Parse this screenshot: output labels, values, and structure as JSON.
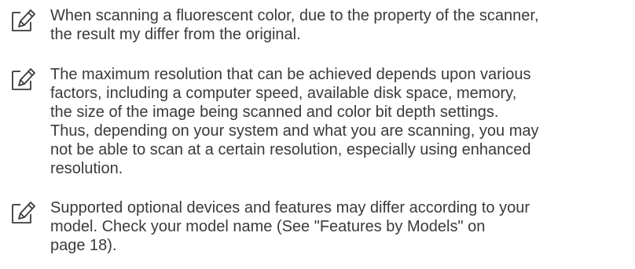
{
  "notes": [
    {
      "icon": "note-pencil-icon",
      "text": "When scanning a fluorescent color, due to the property of the scanner,\nthe result my differ from the original."
    },
    {
      "icon": "note-pencil-icon",
      "text": "The maximum resolution that can be achieved depends upon various\nfactors, including a computer speed, available disk space, memory,\nthe size of the image being scanned and color bit depth settings.\nThus, depending on your system and what you are scanning, you may\nnot be able to scan at a certain resolution, especially using enhanced\nresolution."
    },
    {
      "icon": "note-pencil-icon",
      "text": "Supported optional devices and features may differ according to your\nmodel. Check your model name (See \"Features by Models\" on\npage 18)."
    }
  ],
  "colors": {
    "text": "#3a3a3a",
    "icon_stroke": "#3a3a3a"
  }
}
